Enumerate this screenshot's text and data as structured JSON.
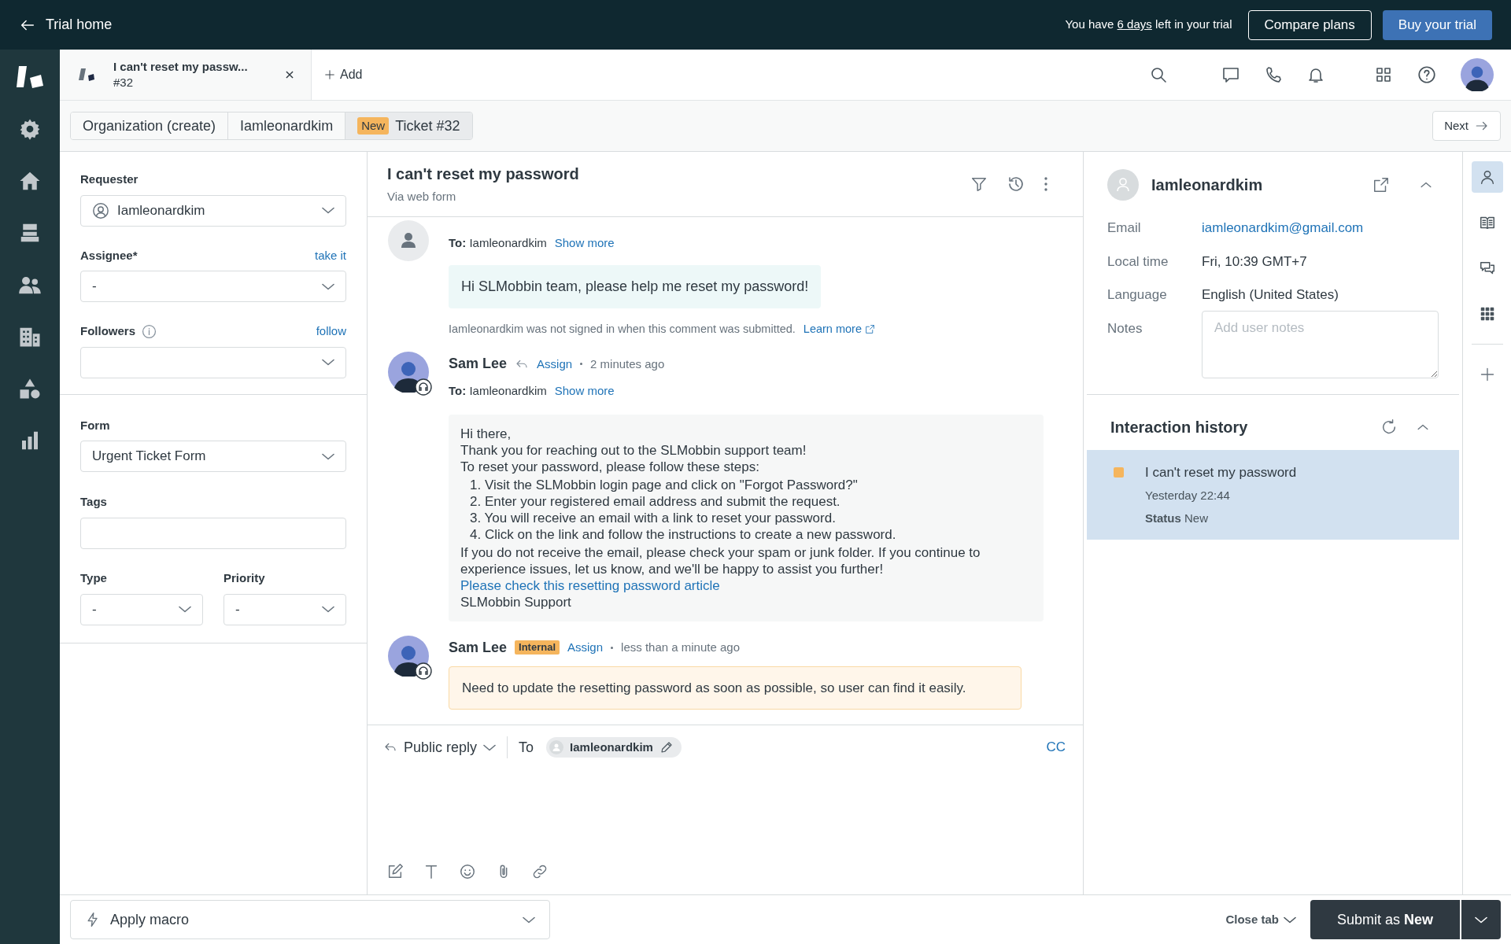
{
  "top_bar": {
    "back_label": "Trial home",
    "trial_prefix": "You have",
    "trial_days": "6 days",
    "trial_suffix": "left in your trial",
    "compare_button": "Compare plans",
    "buy_button": "Buy your trial"
  },
  "tabs": [
    {
      "title": "I can't reset my passw...",
      "subtitle": "#32",
      "selected": true
    }
  ],
  "add_tab": "Add",
  "breadcrumbs": [
    {
      "label": "Organization (create)",
      "selected": false
    },
    {
      "label": "Iamleonardkim",
      "selected": false
    },
    {
      "label": "Ticket #32",
      "badge": "New",
      "selected": true
    }
  ],
  "next_button": "Next",
  "ticket_fields": {
    "requester": {
      "label": "Requester",
      "value": "Iamleonardkim"
    },
    "assignee": {
      "label": "Assignee*",
      "link": "take it",
      "value": "-"
    },
    "followers": {
      "label": "Followers",
      "link": "follow"
    },
    "form": {
      "label": "Form",
      "value": "Urgent Ticket Form"
    },
    "tags": {
      "label": "Tags"
    },
    "type": {
      "label": "Type",
      "value": "-"
    },
    "priority": {
      "label": "Priority",
      "value": "-"
    }
  },
  "conversation": {
    "title": "I can't reset my password",
    "channel": "Via web form",
    "messages": [
      {
        "kind": "customer",
        "to_label": "To:",
        "to": "Iamleonardkim",
        "show_more": "Show more",
        "body": [
          {
            "kind": "line",
            "text": "Hi SLMobbin team, please help me reset my password!"
          }
        ],
        "note": "Iamleonardkim was not signed in when this comment was submitted.",
        "note_link": "Learn more"
      },
      {
        "kind": "public",
        "author": "Sam Lee",
        "action": "Assign",
        "time": "2 minutes ago",
        "to_label": "To:",
        "to": "Iamleonardkim",
        "show_more": "Show more",
        "body": [
          {
            "kind": "line",
            "text": "Hi there,"
          },
          {
            "kind": "line",
            "text": "Thank you for reaching out to the SLMobbin support team!"
          },
          {
            "kind": "line",
            "text": "To reset your password, please follow these steps:"
          },
          {
            "kind": "list",
            "items": [
              {
                "number": "1.",
                "text": "Visit the SLMobbin login page and click on \"Forgot Password?\""
              },
              {
                "number": "2.",
                "text": "Enter your registered email address and submit the request."
              },
              {
                "number": "3.",
                "text": "You will receive an email with a link to reset your password."
              },
              {
                "number": "4.",
                "text": "Click on the link and follow the instructions to create a new password."
              }
            ]
          },
          {
            "kind": "line",
            "text": "If you do not receive the email, please check your spam or junk folder. If you continue to experience issues, let us know, and we'll be happy to assist you further!"
          },
          {
            "kind": "link",
            "text": "Please check this resetting password article"
          },
          {
            "kind": "line",
            "text": "SLMobbin Support"
          }
        ]
      },
      {
        "kind": "internal",
        "author": "Sam Lee",
        "badge": "Internal",
        "action": "Assign",
        "time": "less than a minute ago",
        "body": [
          {
            "kind": "line",
            "text": "Need to update the resetting password as soon as possible, so user can find it easily."
          }
        ]
      }
    ]
  },
  "reply": {
    "mode": "Public reply",
    "to_label": "To",
    "recipient": "Iamleonardkim",
    "cc": "CC"
  },
  "user_panel": {
    "name": "Iamleonardkim",
    "fields": [
      {
        "label": "Email",
        "value": "iamleonardkim@gmail.com",
        "kind": "link"
      },
      {
        "label": "Local time",
        "value": "Fri, 10:39 GMT+7",
        "kind": "text"
      },
      {
        "label": "Language",
        "value": "English (United States)",
        "kind": "text"
      }
    ],
    "notes_label": "Notes",
    "notes_placeholder": "Add user notes"
  },
  "history": {
    "title": "Interaction history",
    "items": [
      {
        "title": "I can't reset my password",
        "time": "Yesterday 22:44",
        "status_label": "Status",
        "status": "New",
        "color": "#f5b55d",
        "selected": true
      }
    ]
  },
  "rail": [
    {
      "kind": "user",
      "selected": true
    },
    {
      "kind": "book",
      "selected": false
    },
    {
      "kind": "chat",
      "selected": false
    },
    {
      "kind": "apps",
      "selected": false
    }
  ],
  "bottom_bar": {
    "macro": "Apply macro",
    "close_tab": "Close tab",
    "submit": "Submit as **New**"
  }
}
